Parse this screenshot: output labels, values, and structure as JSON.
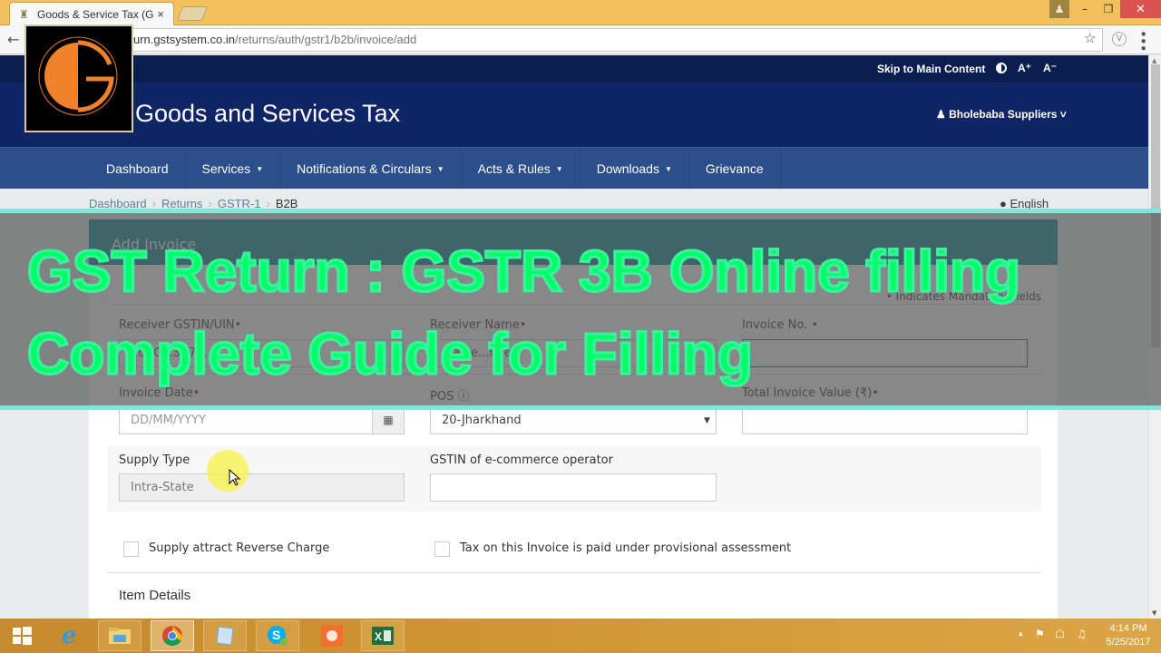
{
  "browser": {
    "tab_title": "Goods & Service Tax (GS",
    "url_host": "urn.gstsystem.co.in",
    "url_path": "/returns/auth/gstr1/b2b/invoice/add",
    "icons": {
      "back": "←",
      "star": "☆",
      "extension": "V",
      "menu": "⋮",
      "tab_close": "×",
      "favicon": "♜"
    },
    "window_controls": {
      "user": "♟",
      "minimize": "–",
      "maximize": "❐",
      "close": "✕"
    }
  },
  "header": {
    "skip_link": "Skip to Main Content",
    "font_increase": "A⁺",
    "font_decrease": "A⁻",
    "site_title": "Goods and Services Tax",
    "user_menu": "♟ Bholebaba Suppliers ˅"
  },
  "nav": {
    "items": [
      {
        "label": "Dashboard",
        "dropdown": false
      },
      {
        "label": "Services",
        "dropdown": true
      },
      {
        "label": "Notifications & Circulars",
        "dropdown": true
      },
      {
        "label": "Acts & Rules",
        "dropdown": true
      },
      {
        "label": "Downloads",
        "dropdown": true
      },
      {
        "label": "Grievance",
        "dropdown": false
      }
    ],
    "caret": "▼"
  },
  "breadcrumb": {
    "items": [
      "Dashboard",
      "Returns",
      "GSTR-1",
      "B2B"
    ],
    "separator": "›"
  },
  "language": "● English",
  "form": {
    "title": "Add Invoice",
    "mandatory_note": "Indicates Mandatory Fields",
    "required_mark": "•",
    "fields": {
      "receiver_gstin": {
        "label": "Receiver GSTIN/UIN",
        "value": "20AC...3C7..."
      },
      "receiver_name": {
        "label": "Receiver Name",
        "value": "...ajee...ndev"
      },
      "invoice_no": {
        "label": "Invoice No.",
        "value": ""
      },
      "invoice_date": {
        "label": "Invoice Date",
        "placeholder": "DD/MM/YYYY"
      },
      "pos": {
        "label": "POS",
        "value": "20-Jharkhand",
        "info_icon": "ⓘ"
      },
      "total_invoice_value": {
        "label": "Total Invoice Value (₹)",
        "value": ""
      },
      "supply_type": {
        "label": "Supply Type",
        "value": "Intra-State"
      },
      "ecommerce_gstin": {
        "label": "GSTIN of e-commerce operator",
        "value": ""
      }
    },
    "checkboxes": {
      "reverse_charge": {
        "label": "Supply attract Reverse Charge",
        "checked": false
      },
      "provisional": {
        "label": "Tax on this Invoice is paid under provisional assessment",
        "checked": false
      }
    },
    "section_item_details": "Item Details",
    "calendar_icon": "▦",
    "select_caret": "▼"
  },
  "overlay": {
    "line1": "GST Return : GSTR 3B Online filling",
    "line2": "Complete Guide for Filling"
  },
  "taskbar": {
    "apps": [
      "start",
      "internet-explorer",
      "file-explorer",
      "chrome",
      "notepad",
      "skype",
      "screen-recorder",
      "excel"
    ],
    "time": "4:14 PM",
    "date": "5/25/2017",
    "tray_icons": {
      "expand": "▴",
      "flag": "⚑",
      "network": "☖",
      "volume": "♫"
    }
  },
  "scrollbar": {
    "position_fraction": 0.0,
    "up": "▲",
    "down": "▼"
  },
  "colors": {
    "gst_navy": "#0f2566",
    "gst_nav": "#2c4e8a",
    "card_header": "#0f8b94",
    "overlay_text": "#00ff66",
    "required": "#a51b0b"
  }
}
